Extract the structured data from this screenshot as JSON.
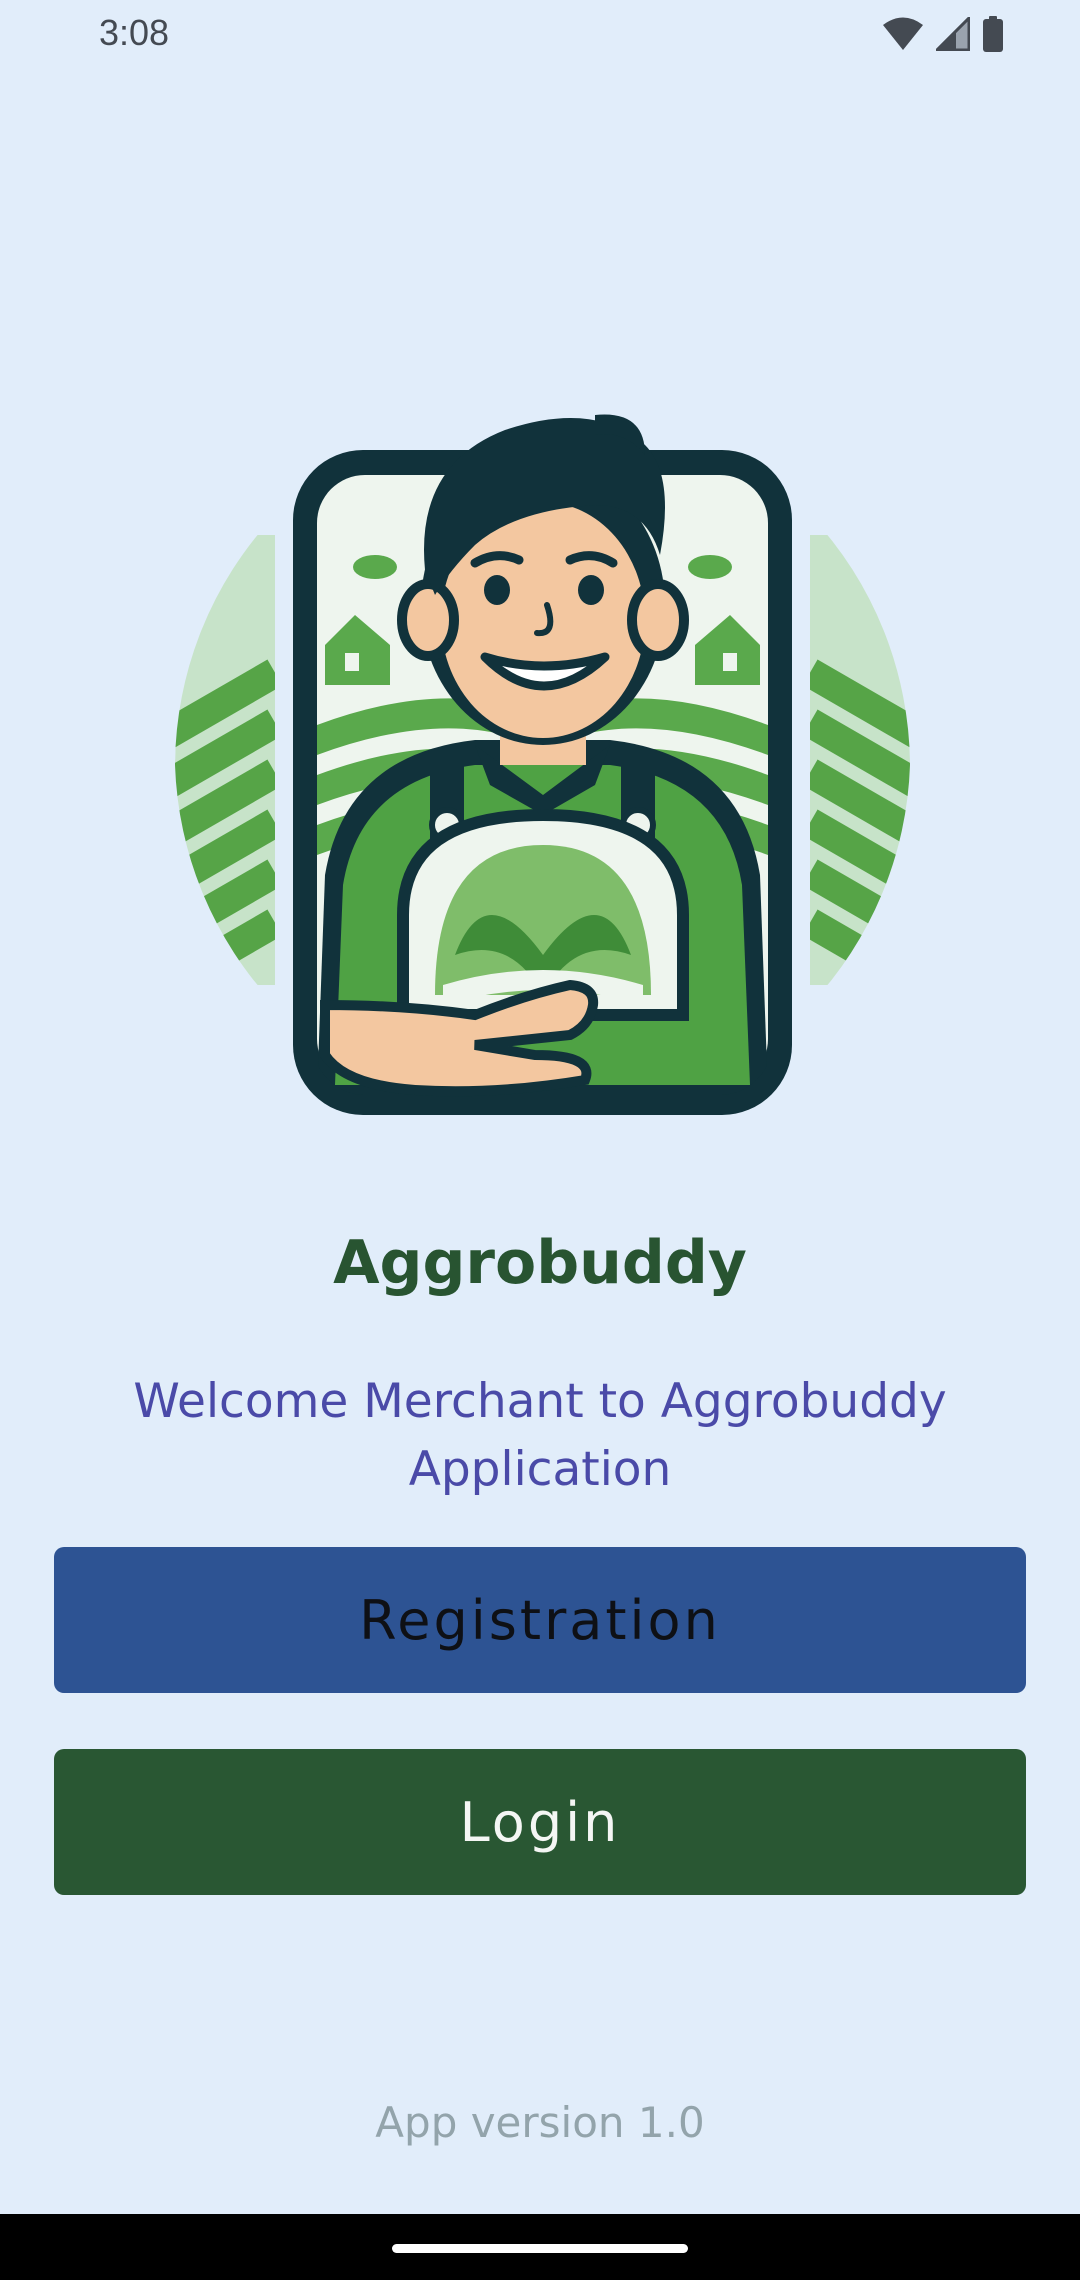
{
  "status_bar": {
    "time": "3:08",
    "icons": [
      "wifi-icon",
      "cellular-signal-icon",
      "battery-icon"
    ]
  },
  "logo": {
    "description_icon": "farmer-merchant-logo-icon"
  },
  "app": {
    "title": "Aggrobuddy",
    "welcome_message": "Welcome Merchant to Aggrobuddy Application",
    "version": "App version 1.0"
  },
  "actions": {
    "registration_label": "Registration",
    "login_label": "Login"
  },
  "colors": {
    "background": "#e1edfa",
    "title": "#285431",
    "welcome_text": "#4a4aa8",
    "registration_button": "#2d5393",
    "login_button": "#295733",
    "version_text": "#93a4ab"
  }
}
